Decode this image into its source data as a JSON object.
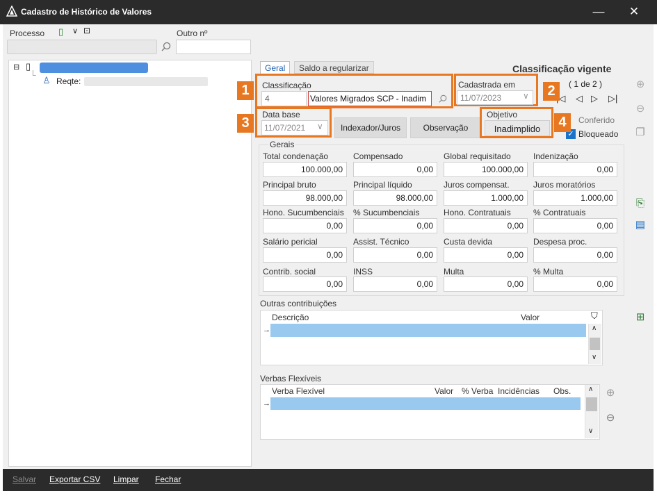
{
  "window": {
    "title": "Cadastro de Histórico de Valores",
    "minimize": "—",
    "close": "✕"
  },
  "header": {
    "processo_label": "Processo",
    "outro_label": "Outro nº"
  },
  "tree": {
    "reqte_label": "Reqte:"
  },
  "tabs": [
    {
      "label": "Geral"
    },
    {
      "label": "Saldo a regularizar"
    }
  ],
  "vigente": {
    "title": "Classificação vigente",
    "pager": "( 1 de 2 )"
  },
  "classificacao": {
    "label": "Classificação",
    "code": "4",
    "value": "Valores Migrados SCP  - Inadim"
  },
  "cadastrada": {
    "label": "Cadastrada em",
    "value": "11/07/2023"
  },
  "database": {
    "label": "Data base",
    "value": "11/07/2021"
  },
  "buttons": {
    "indexador": "Indexador/Juros",
    "observacao": "Observação"
  },
  "objetivo": {
    "label": "Objetivo",
    "value": "Inadimplido"
  },
  "flags": {
    "conferido": "Conferido",
    "bloqueado": "Bloqueado"
  },
  "gerais": {
    "label": "Gerais",
    "rows": [
      [
        {
          "label": "Total condenação",
          "value": "100.000,00"
        },
        {
          "label": "Compensado",
          "value": "0,00"
        },
        {
          "label": "Global requisitado",
          "value": "100.000,00"
        },
        {
          "label": "Indenização",
          "value": "0,00"
        }
      ],
      [
        {
          "label": "Principal bruto",
          "value": "98.000,00"
        },
        {
          "label": "Principal líquido",
          "value": "98.000,00"
        },
        {
          "label": "Juros compensat.",
          "value": "1.000,00"
        },
        {
          "label": "Juros moratórios",
          "value": "1.000,00"
        }
      ],
      [
        {
          "label": "Hono. Sucumbenciais",
          "value": "0,00"
        },
        {
          "label": "% Sucumbenciais",
          "value": "0,00"
        },
        {
          "label": "Hono. Contratuais",
          "value": "0,00"
        },
        {
          "label": "% Contratuais",
          "value": "0,00"
        }
      ],
      [
        {
          "label": "Salário pericial",
          "value": "0,00"
        },
        {
          "label": "Assist. Técnico",
          "value": "0,00"
        },
        {
          "label": "Custa devida",
          "value": "0,00"
        },
        {
          "label": "Despesa proc.",
          "value": "0,00"
        }
      ],
      [
        {
          "label": "Contrib. social",
          "value": "0,00"
        },
        {
          "label": "INSS",
          "value": "0,00"
        },
        {
          "label": "Multa",
          "value": "0,00"
        },
        {
          "label": "% Multa",
          "value": "0,00"
        }
      ]
    ]
  },
  "outras": {
    "label": "Outras contribuições",
    "col_descricao": "Descrição",
    "col_valor": "Valor"
  },
  "verbas": {
    "label": "Verbas Flexíveis",
    "col_verba": "Verba Flexível",
    "col_valor": "Valor",
    "col_pct": "% Verba",
    "col_inc": "Incidências",
    "col_obs": "Obs."
  },
  "footer": {
    "salvar": "Salvar",
    "exportar": "Exportar CSV",
    "limpar": "Limpar",
    "fechar": "Fechar"
  },
  "callouts": [
    "1",
    "2",
    "3",
    "4"
  ]
}
